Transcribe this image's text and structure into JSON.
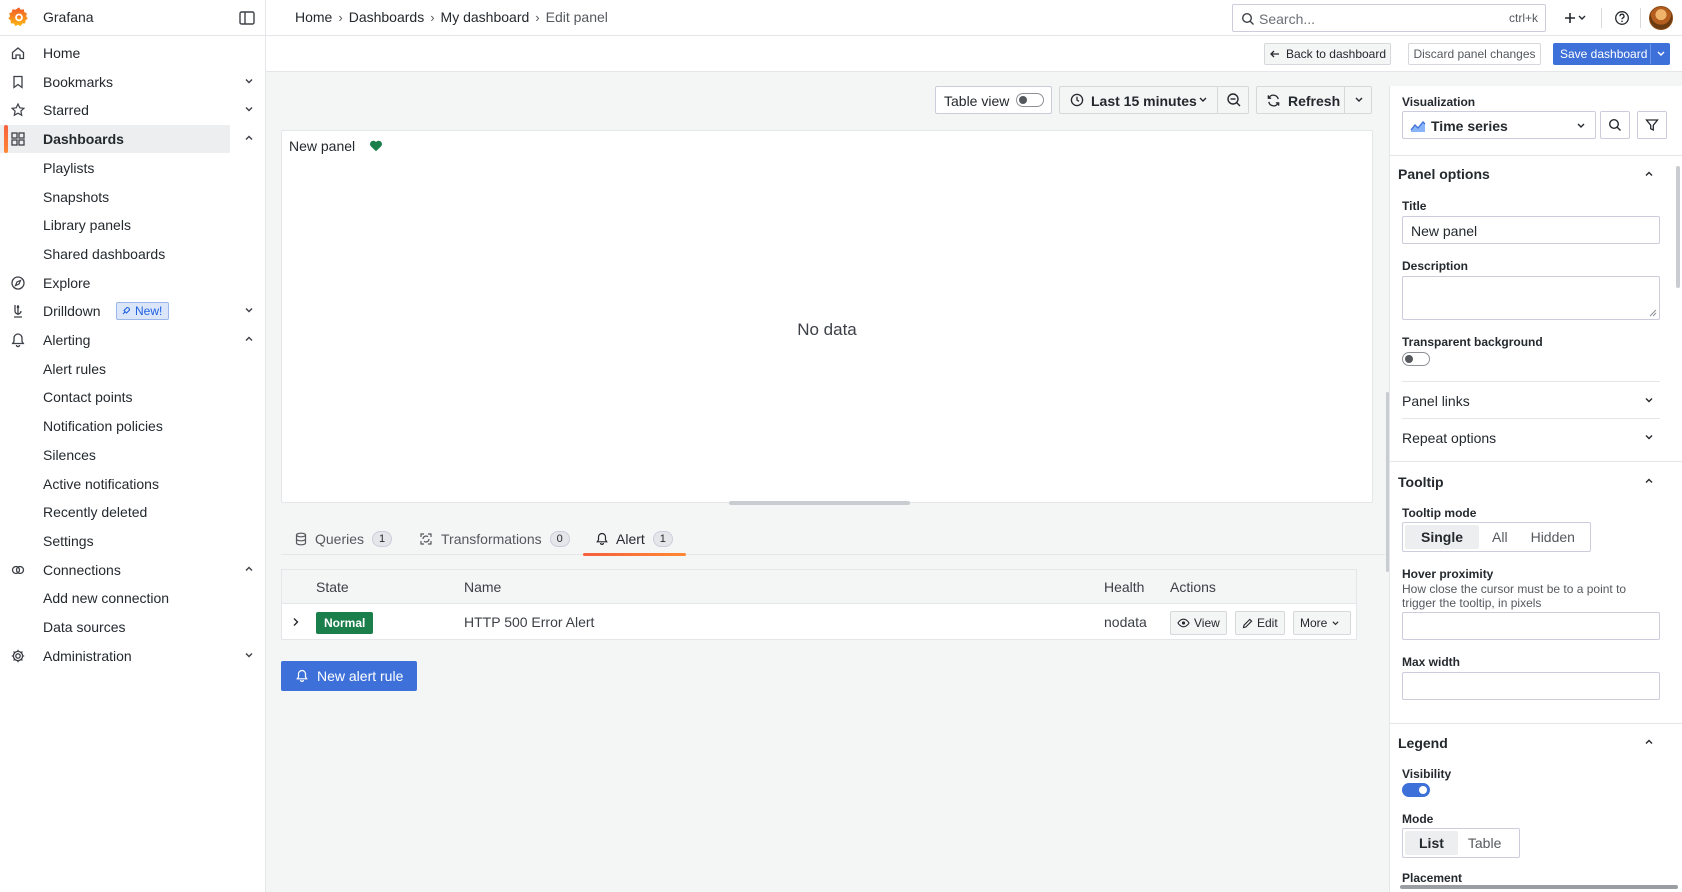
{
  "app": {
    "brand": "Grafana"
  },
  "breadcrumb": [
    "Home",
    "Dashboards",
    "My dashboard",
    "Edit panel"
  ],
  "search": {
    "placeholder": "Search...",
    "shortcut": "ctrl+k"
  },
  "sidebar": {
    "items": [
      {
        "label": "Home",
        "icon": "home-icon"
      },
      {
        "label": "Bookmarks",
        "icon": "bookmark-icon",
        "chevron": "down"
      },
      {
        "label": "Starred",
        "icon": "star-icon",
        "chevron": "down"
      },
      {
        "label": "Dashboards",
        "icon": "grid-icon",
        "chevron": "up",
        "active": true
      },
      {
        "label": "Playlists"
      },
      {
        "label": "Snapshots"
      },
      {
        "label": "Library panels"
      },
      {
        "label": "Shared dashboards"
      },
      {
        "label": "Explore",
        "icon": "compass-icon"
      },
      {
        "label": "Drilldown",
        "icon": "drilldown-icon",
        "chevron": "down",
        "badge": "New!"
      },
      {
        "label": "Alerting",
        "icon": "bell-icon",
        "chevron": "up"
      },
      {
        "label": "Alert rules"
      },
      {
        "label": "Contact points"
      },
      {
        "label": "Notification policies"
      },
      {
        "label": "Silences"
      },
      {
        "label": "Active notifications"
      },
      {
        "label": "Recently deleted"
      },
      {
        "label": "Settings"
      },
      {
        "label": "Connections",
        "icon": "connections-icon",
        "chevron": "up"
      },
      {
        "label": "Add new connection"
      },
      {
        "label": "Data sources"
      },
      {
        "label": "Administration",
        "icon": "cog-icon",
        "chevron": "down"
      }
    ]
  },
  "subbar": {
    "back": "Back to dashboard",
    "discard": "Discard panel changes",
    "save": "Save dashboard"
  },
  "viz_toolbar": {
    "table_view": "Table view",
    "time_range": "Last 15 minutes",
    "refresh": "Refresh"
  },
  "panel": {
    "title": "New panel",
    "empty": "No data"
  },
  "tabs": [
    {
      "label": "Queries",
      "count": "1",
      "icon": "database-icon"
    },
    {
      "label": "Transformations",
      "count": "0",
      "icon": "transform-icon"
    },
    {
      "label": "Alert",
      "count": "1",
      "icon": "bell-icon",
      "active": true
    }
  ],
  "alerts": {
    "columns": [
      "State",
      "Name",
      "Health",
      "Actions"
    ],
    "rows": [
      {
        "state": "Normal",
        "name": "HTTP 500 Error Alert",
        "health": "nodata"
      }
    ],
    "actions": [
      "View",
      "Edit",
      "More"
    ],
    "new_rule": "New alert rule"
  },
  "options": {
    "visualization_label": "Visualization",
    "visualization": "Time series",
    "panel_options": {
      "header": "Panel options",
      "title_label": "Title",
      "title_value": "New panel",
      "description_label": "Description",
      "transparent_label": "Transparent background",
      "transparent": false,
      "panel_links": "Panel links",
      "repeat_options": "Repeat options"
    },
    "tooltip": {
      "header": "Tooltip",
      "mode_label": "Tooltip mode",
      "modes": [
        "Single",
        "All",
        "Hidden"
      ],
      "selected": "Single",
      "hover_label": "Hover proximity",
      "hover_desc": "How close the cursor must be to a point to trigger the tooltip, in pixels",
      "max_width_label": "Max width"
    },
    "legend": {
      "header": "Legend",
      "visibility_label": "Visibility",
      "visibility": true,
      "mode_label": "Mode",
      "modes": [
        "List",
        "Table"
      ],
      "selected": "List",
      "placement_label": "Placement"
    }
  },
  "colors": {
    "accent": "#3d71d9",
    "brand_gradient_start": "#f55f3e",
    "brand_gradient_end": "#ff8833",
    "state_normal": "#1a7f4b",
    "heart": "#1a7f4b"
  }
}
